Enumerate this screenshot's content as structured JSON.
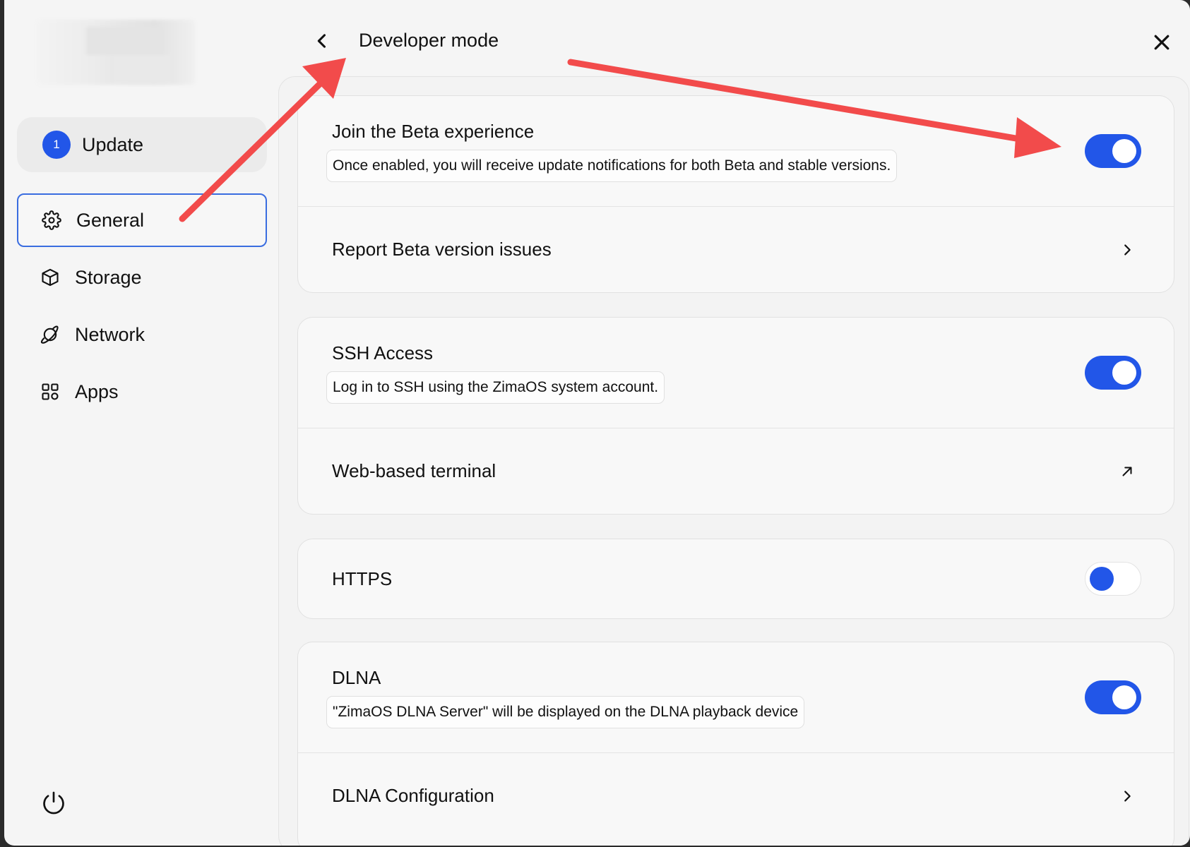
{
  "sidebar": {
    "update": {
      "badge": "1",
      "label": "Update"
    },
    "items": [
      {
        "label": "General",
        "icon": "gear-icon",
        "active": true
      },
      {
        "label": "Storage",
        "icon": "cube-icon",
        "active": false
      },
      {
        "label": "Network",
        "icon": "planet-icon",
        "active": false
      },
      {
        "label": "Apps",
        "icon": "apps-grid-icon",
        "active": false
      }
    ],
    "power_icon": "power-icon"
  },
  "header": {
    "title": "Developer mode",
    "back_icon": "chevron-left-icon",
    "close_icon": "close-icon"
  },
  "cards": [
    {
      "rows": [
        {
          "title": "Join the Beta experience",
          "desc": "Once enabled, you will receive update notifications for both Beta and stable versions.",
          "control": "toggle",
          "state": "on"
        },
        {
          "title": "Report Beta version issues",
          "control": "chevron"
        }
      ]
    },
    {
      "rows": [
        {
          "title": "SSH Access",
          "desc": "Log in to SSH using the ZimaOS system account.",
          "control": "toggle",
          "state": "on"
        },
        {
          "title": "Web-based terminal",
          "control": "external"
        }
      ]
    },
    {
      "rows": [
        {
          "title": "HTTPS",
          "control": "toggle",
          "state": "off"
        }
      ]
    },
    {
      "rows": [
        {
          "title": "DLNA",
          "desc": "\"ZimaOS DLNA Server\" will be displayed on the DLNA playback device",
          "control": "toggle",
          "state": "on"
        },
        {
          "title": "DLNA Configuration",
          "control": "chevron"
        }
      ]
    }
  ],
  "colors": {
    "accent": "#2256e8",
    "annotation_arrow": "#f24b4b",
    "active_border": "#3a6de0"
  }
}
